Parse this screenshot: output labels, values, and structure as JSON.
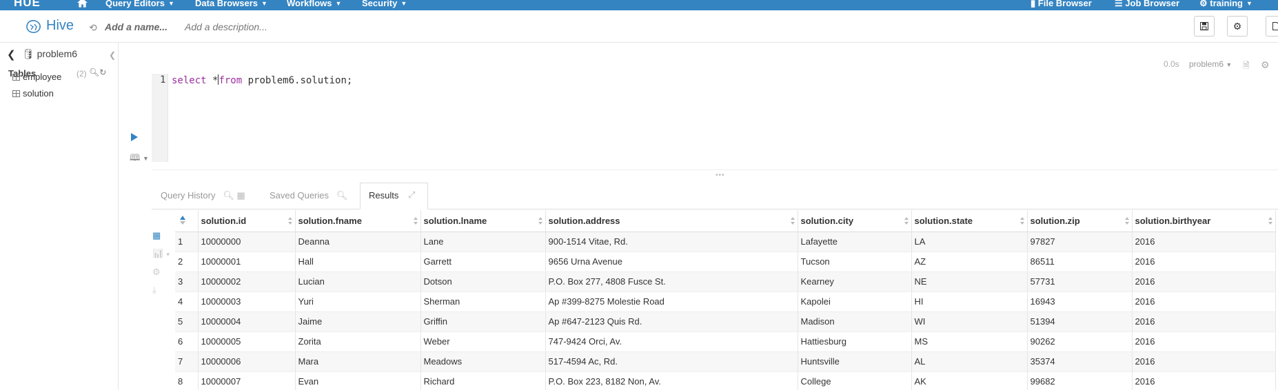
{
  "topnav": {
    "logo": "HUE",
    "menus": [
      {
        "label": "Query Editors"
      },
      {
        "label": "Data Browsers"
      },
      {
        "label": "Workflows"
      },
      {
        "label": "Security"
      }
    ],
    "right": [
      {
        "label": "File Browser"
      },
      {
        "label": "Job Browser"
      },
      {
        "label": "training"
      }
    ]
  },
  "editorbar": {
    "title": "Hive",
    "name_placeholder": "Add a name...",
    "description_placeholder": "Add a description..."
  },
  "left_panel": {
    "database": "problem6",
    "tables_label": "Tables",
    "tables_count": "(2)",
    "tables": [
      "employee",
      "solution"
    ]
  },
  "editor": {
    "duration": "0.0s",
    "database": "problem6",
    "line_number": "1",
    "code": {
      "kw1": "select",
      "star": " *",
      "kw2": "from",
      "rest": " problem6.solution;"
    }
  },
  "tabs": {
    "history": "Query History",
    "saved": "Saved Queries",
    "results": "Results"
  },
  "results": {
    "columns": [
      "solution.id",
      "solution.fname",
      "solution.lname",
      "solution.address",
      "solution.city",
      "solution.state",
      "solution.zip",
      "solution.birthyear"
    ],
    "rows": [
      [
        "1",
        "10000000",
        "Deanna",
        "Lane",
        "900-1514 Vitae, Rd.",
        "Lafayette",
        "LA",
        "97827",
        "2016"
      ],
      [
        "2",
        "10000001",
        "Hall",
        "Garrett",
        "9656 Urna Avenue",
        "Tucson",
        "AZ",
        "86511",
        "2016"
      ],
      [
        "3",
        "10000002",
        "Lucian",
        "Dotson",
        "P.O. Box 277, 4808 Fusce St.",
        "Kearney",
        "NE",
        "57731",
        "2016"
      ],
      [
        "4",
        "10000003",
        "Yuri",
        "Sherman",
        "Ap #399-8275 Molestie Road",
        "Kapolei",
        "HI",
        "16943",
        "2016"
      ],
      [
        "5",
        "10000004",
        "Jaime",
        "Griffin",
        "Ap #647-2123 Quis Rd.",
        "Madison",
        "WI",
        "51394",
        "2016"
      ],
      [
        "6",
        "10000005",
        "Zorita",
        "Weber",
        "747-9424 Orci, Av.",
        "Hattiesburg",
        "MS",
        "90262",
        "2016"
      ],
      [
        "7",
        "10000006",
        "Mara",
        "Meadows",
        "517-4594 Ac, Rd.",
        "Huntsville",
        "AL",
        "35374",
        "2016"
      ],
      [
        "8",
        "10000007",
        "Evan",
        "Richard",
        "P.O. Box 223, 8182 Non, Av.",
        "College",
        "AK",
        "99682",
        "2016"
      ]
    ]
  },
  "colors": {
    "brand": "#3484c2",
    "keyword": "#9c2fa0"
  }
}
